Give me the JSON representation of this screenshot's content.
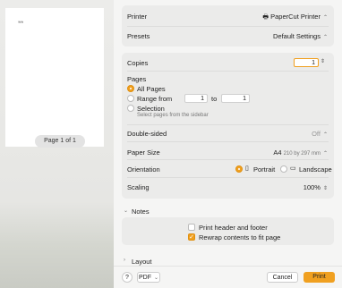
{
  "preview": {
    "page_indicator": "Page 1 of 1",
    "marks": "≈≈"
  },
  "printer": {
    "label": "Printer",
    "value": "PaperCut Printer"
  },
  "presets": {
    "label": "Presets",
    "value": "Default Settings"
  },
  "copies": {
    "label": "Copies",
    "value": "1"
  },
  "pages": {
    "label": "Pages",
    "all": "All Pages",
    "range": "Range from",
    "range_from": "1",
    "range_to_label": "to",
    "range_to": "1",
    "selection": "Selection",
    "selection_hint": "Select pages from the sidebar"
  },
  "double_sided": {
    "label": "Double-sided",
    "value": "Off"
  },
  "paper_size": {
    "label": "Paper Size",
    "value": "A4",
    "dims": "210 by 297 mm"
  },
  "orientation": {
    "label": "Orientation",
    "portrait": "Portrait",
    "landscape": "Landscape"
  },
  "scaling": {
    "label": "Scaling",
    "value": "100%"
  },
  "notes": {
    "header": "Notes",
    "print_header": "Print header and footer",
    "rewrap": "Rewrap contents to fit page"
  },
  "layout": {
    "header": "Layout"
  },
  "footer": {
    "help": "?",
    "pdf": "PDF",
    "cancel": "Cancel",
    "print": "Print"
  },
  "colors": {
    "accent": "#f0a020"
  }
}
